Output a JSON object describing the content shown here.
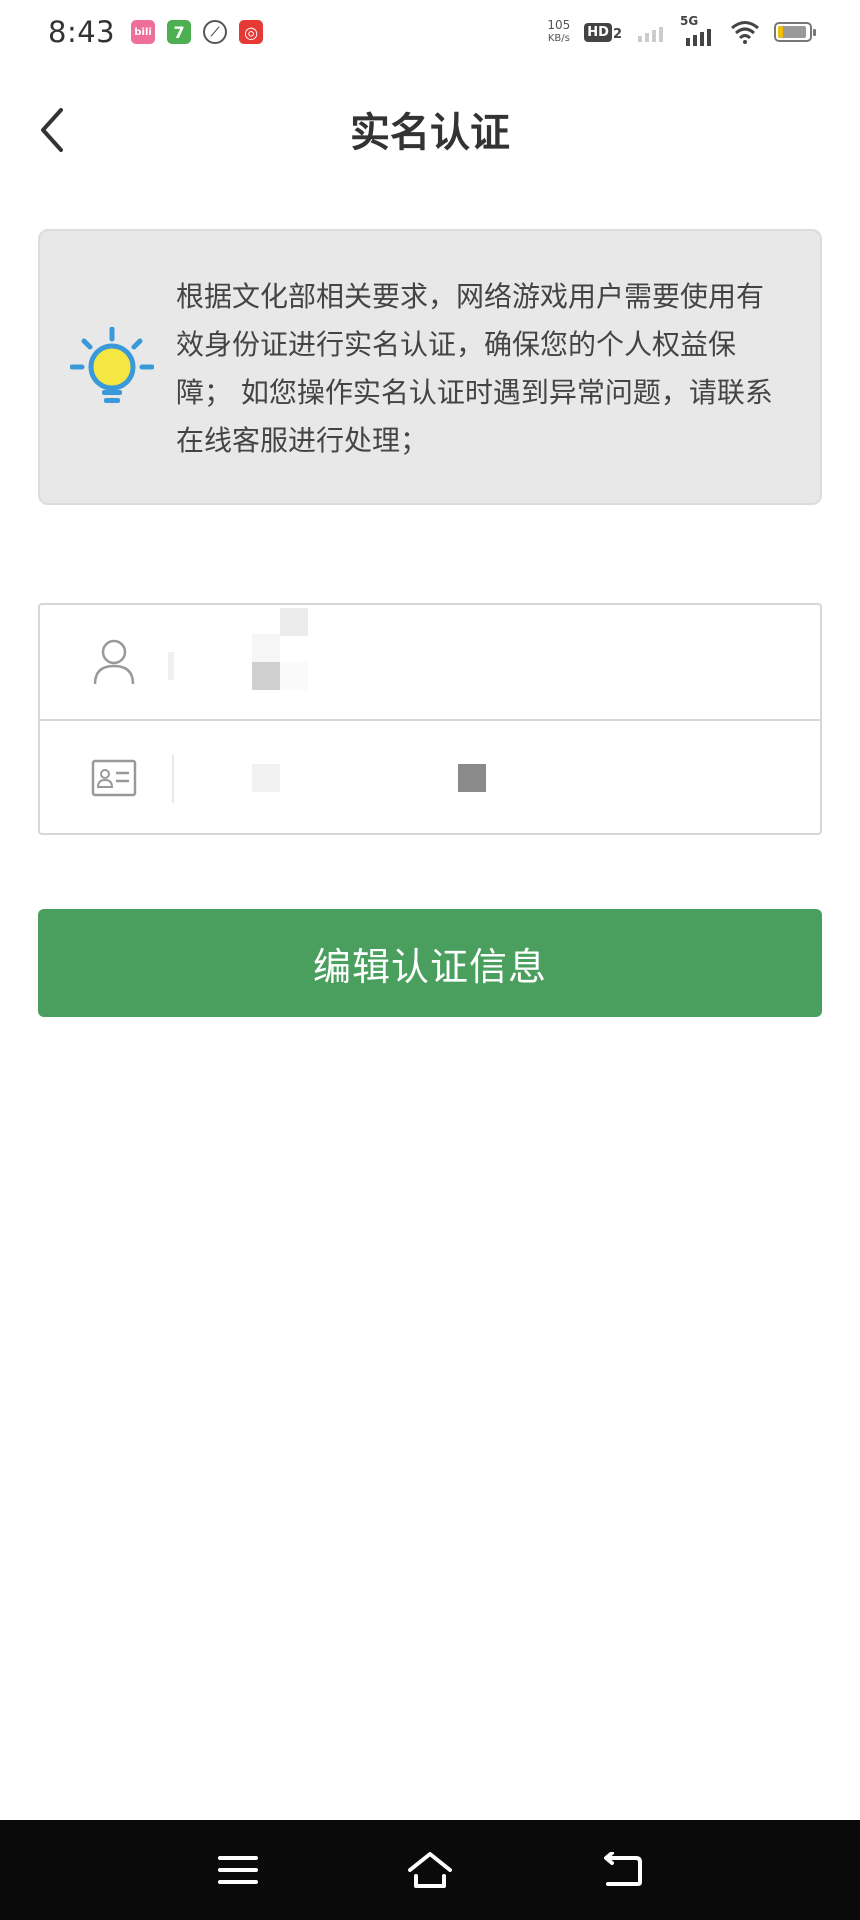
{
  "status_bar": {
    "time": "8:43",
    "apps": [
      {
        "name": "bilibili-app-icon",
        "glyph": "bili",
        "color": "#f06e9b"
      },
      {
        "name": "seven-app-icon",
        "glyph": "7",
        "color": "#4caf50"
      },
      {
        "name": "ball-app-icon",
        "glyph": "⚾",
        "color": "#555555"
      },
      {
        "name": "netease-app-icon",
        "glyph": "◎",
        "color": "#e53935"
      }
    ],
    "speed_value": "105",
    "speed_unit": "KB/s",
    "hd_label": "HD",
    "hd_sub": "2",
    "network_label": "5G",
    "battery_level": 0.85
  },
  "header": {
    "title": "实名认证"
  },
  "notice": {
    "text": "根据文化部相关要求，网络游戏用户需要使用有效身份证进行实名认证，确保您的个人权益保障； 如您操作实名认证时遇到异常问题，请联系在线客服进行处理；"
  },
  "form": {
    "name_icon": "user-icon",
    "id_icon": "id-card-icon"
  },
  "actions": {
    "edit_label": "编辑认证信息"
  },
  "colors": {
    "accent": "#4a9f5e",
    "notice_bg": "#e8e8e8",
    "nav_bg": "#0a0a0a"
  }
}
